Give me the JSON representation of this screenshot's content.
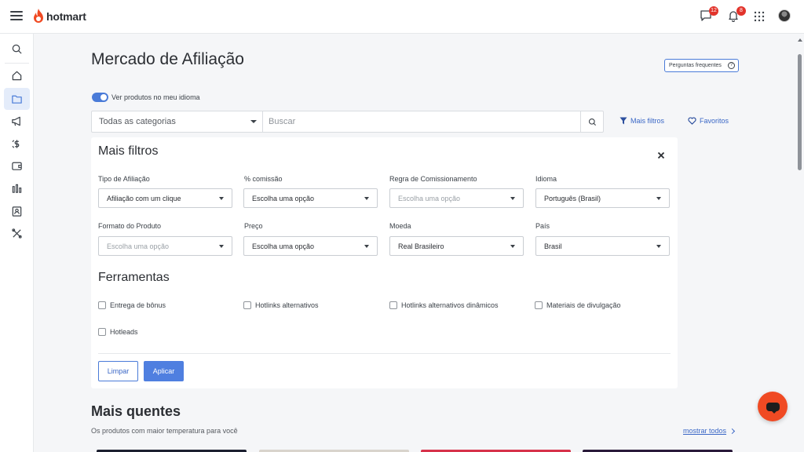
{
  "app": {
    "logo_text": "hotmart"
  },
  "topbar": {
    "icons": [
      "hamburger-icon",
      "chat-icon",
      "bell-icon",
      "apps-grid-icon",
      "avatar"
    ],
    "chat_badge": "12",
    "notification_badge": "8"
  },
  "sidebar": {
    "items": [
      "search-icon",
      "home-icon",
      "folder-icon",
      "megaphone-icon",
      "dollar-transfer-icon",
      "wallet-icon",
      "chart-icon",
      "contacts-icon",
      "tools-icon"
    ],
    "active": "folder-icon"
  },
  "main": {
    "title": "Mercado de Afiliação",
    "faq_label": "Perguntas frequentes",
    "toggle_label": "Ver produtos no meu idioma",
    "toggle_on": true,
    "category_select": "Todas as categorias",
    "search_placeholder": "Buscar",
    "more_filters_label": "Mais filtros",
    "favorites_label": "Favoritos"
  },
  "filters": {
    "title": "Mais filtros",
    "fields": [
      {
        "label": "Tipo de Afiliação",
        "value": "Afiliação com um clique"
      },
      {
        "label": "% comissão",
        "value": "Escolha uma opção"
      },
      {
        "label": "Regra de Comissionamento",
        "value": "Escolha uma opção"
      },
      {
        "label": "Idioma",
        "value": "Português (Brasil)"
      },
      {
        "label": "Formato do Produto",
        "value": "Escolha uma opção"
      },
      {
        "label": "Preço",
        "value": "Escolha uma opção"
      },
      {
        "label": "Moeda",
        "value": "Real Brasileiro"
      },
      {
        "label": "País",
        "value": "Brasil"
      }
    ],
    "tools_title": "Ferramentas",
    "tools": [
      "Entrega de bônus",
      "Hotlinks alternativos",
      "Hotlinks alternativos dinâmicos",
      "Materiais de divulgação",
      "Hotleads"
    ],
    "clear_label": "Limpar",
    "apply_label": "Aplicar"
  },
  "hot": {
    "title": "Mais quentes",
    "subtitle": "Os produtos com maior temperatura para você",
    "see_all": "mostrar todos"
  },
  "colors": {
    "accent": "#4f7fe0",
    "brand": "#f04a23",
    "badge": "#e2332b"
  }
}
